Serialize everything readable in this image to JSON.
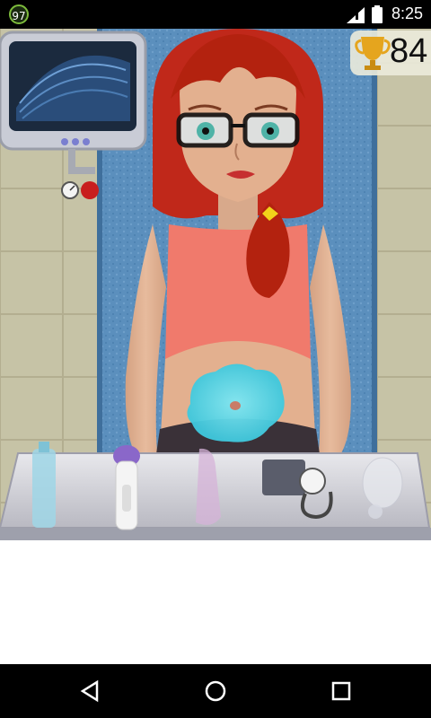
{
  "status_bar": {
    "badge": "97",
    "time": "8:25"
  },
  "score": {
    "value": "84",
    "icon": "trophy-icon"
  },
  "tools": [
    {
      "name": "gel-bottle"
    },
    {
      "name": "ultrasound-probe"
    },
    {
      "name": "speculum"
    },
    {
      "name": "blood-pressure-monitor"
    },
    {
      "name": "oxygen-mask"
    }
  ],
  "nav": {
    "back": "back-icon",
    "home": "home-icon",
    "recents": "recents-icon"
  },
  "colors": {
    "hair": "#c0281a",
    "top": "#f07a6c",
    "gel": "#47d4e8",
    "curtain": "#5b8fbd",
    "accent": "#8a67c9"
  }
}
